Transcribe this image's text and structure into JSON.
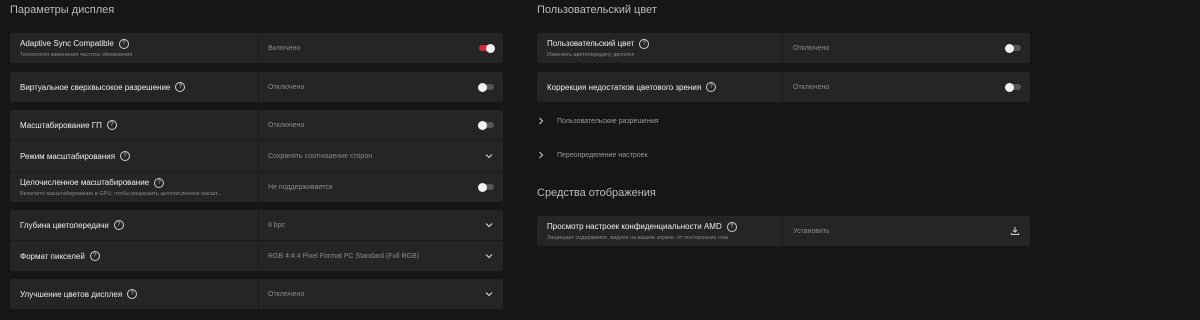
{
  "display": {
    "title": "Параметры дисплея",
    "adaptive_sync": {
      "label": "Adaptive Sync Compatible",
      "sub": "Технология изменения частоты обновления",
      "value": "Включено",
      "toggle": "on"
    },
    "vsr": {
      "label": "Виртуальное сверхвысокое разрешение",
      "value": "Отключено",
      "toggle": "off"
    },
    "gpu_scaling": {
      "label": "Масштабирование ГП",
      "value": "Отключено",
      "toggle": "off"
    },
    "scaling_mode": {
      "label": "Режим масштабирования",
      "value": "Сохранять соотношение сторон"
    },
    "integer_scaling": {
      "label": "Целочисленное масштабирование",
      "sub": "Включите масштабирование в GPU, чтобы разрешить целочисленное масшт...",
      "value": "Не поддерживается",
      "toggle": "off"
    },
    "color_depth": {
      "label": "Глубина цветопередачи",
      "value": "8 bpc"
    },
    "pixel_format": {
      "label": "Формат пикселей",
      "value": "RGB 4:4:4 Pixel Format PC Standard (Full RGB)"
    },
    "color_enhance": {
      "label": "Улучшение цветов дисплея",
      "value": "Отключено"
    }
  },
  "custom_color": {
    "title": "Пользовательский цвет",
    "custom_color_row": {
      "label": "Пользовательский цвет",
      "sub": "Изменить цветопередачу дисплея",
      "value": "Отключено",
      "toggle": "off"
    },
    "color_correction": {
      "label": "Коррекция недостатков цветового зрения",
      "value": "Отключено",
      "toggle": "off"
    },
    "links": [
      "Пользовательские разрешения",
      "Переопределение настроек"
    ]
  },
  "display_tools": {
    "title": "Средства отображения",
    "privacy_view": {
      "label": "Просмотр настроек конфиденциальности AMD",
      "sub": "Защищает содержимое, видное на вашем экране, от посторонних глаз",
      "value": "Установить"
    }
  }
}
